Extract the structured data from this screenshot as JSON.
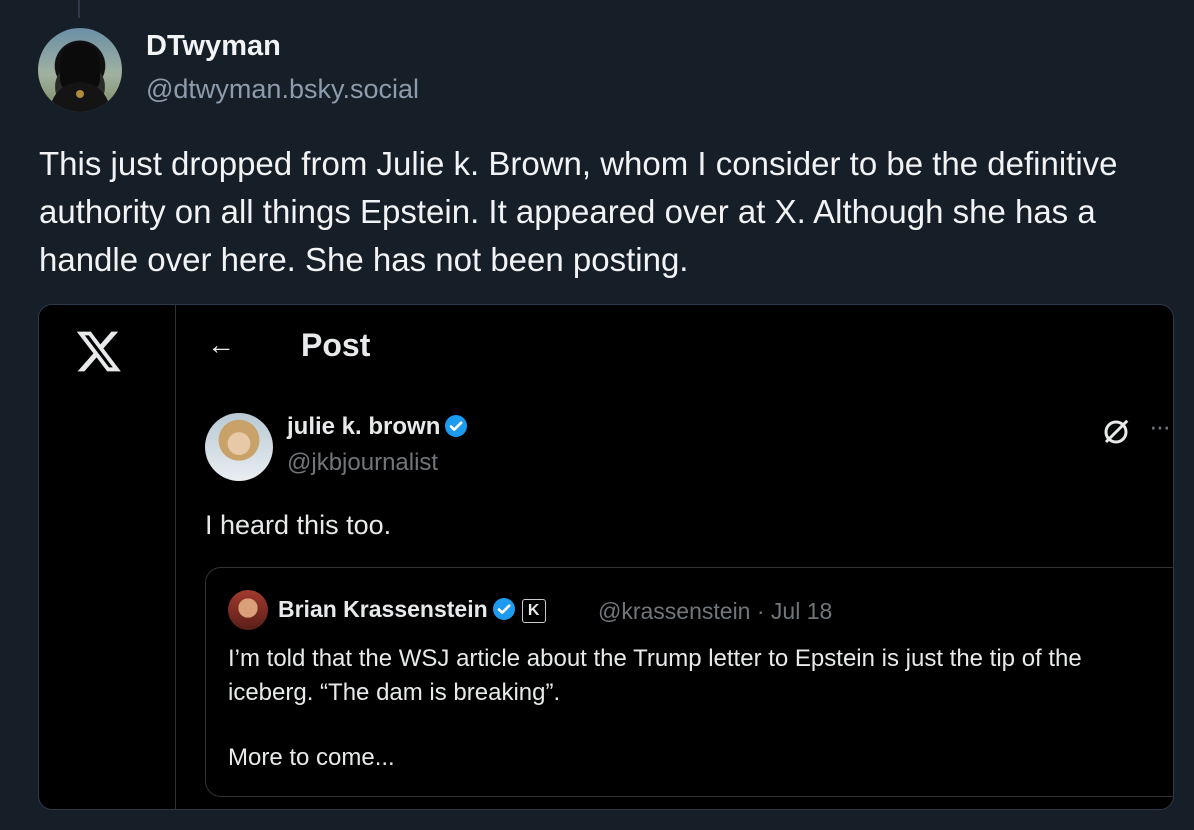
{
  "author": {
    "display_name": "DTwyman",
    "handle": "@dtwyman.bsky.social"
  },
  "post": {
    "text": "This just dropped from Julie k. Brown, whom I consider to be the definitive authority on all things Epstein. It appeared over at X. Although she has a handle over here. She has not been posting."
  },
  "embed": {
    "header_title": "Post",
    "tweet": {
      "display_name": "julie k. brown",
      "handle": "@jkbjournalist",
      "text": "I heard this too.",
      "more_icon": "···"
    },
    "quoted": {
      "display_name": "Brian Krassenstein",
      "badge_letter": "K",
      "handle_date": "@krassenstein · Jul 18",
      "text": "I’m told that the WSJ article about the Trump letter to Epstein is just the tip of the iceberg. “The dam is breaking”.",
      "more_text": "More to come..."
    },
    "back_icon": "←"
  },
  "colors": {
    "background": "#161e27",
    "embed_background": "#000000",
    "verified": "#1d9bf0",
    "muted": "#71767b"
  }
}
